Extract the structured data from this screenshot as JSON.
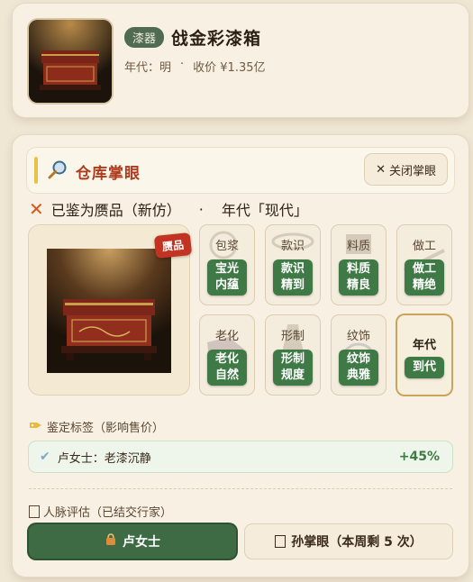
{
  "item": {
    "category": "漆器",
    "name": "戗金彩漆箱",
    "era_label": "年代：明",
    "separator": "·",
    "price_label": "收价 ¥1.35亿"
  },
  "inspection": {
    "title": "仓库掌眼",
    "close_label": "关闭掌眼",
    "verdict_text": "已鉴为赝品（新仿）",
    "verdict_sep": "·",
    "verdict_era": "年代「现代」",
    "stamp": "赝品"
  },
  "attributes": [
    {
      "label": "包浆",
      "value": "宝光内蕴"
    },
    {
      "label": "款识",
      "value": "款识精到"
    },
    {
      "label": "料质",
      "value": "料质精良"
    },
    {
      "label": "做工",
      "value": "做工精绝"
    },
    {
      "label": "老化",
      "value": "老化自然"
    },
    {
      "label": "形制",
      "value": "形制规度"
    },
    {
      "label": "纹饰",
      "value": "纹饰典雅"
    },
    {
      "label": "年代",
      "value": "到代"
    }
  ],
  "tags_section": {
    "label": "鉴定标签（影响售价）",
    "tags": [
      {
        "text": "卢女士：老漆沉静",
        "effect": "+45%"
      }
    ]
  },
  "network_section": {
    "label": "人脉评估（已结交行家）",
    "buttons": [
      {
        "label": "卢女士"
      },
      {
        "label": "孙掌眼（本周剩 5 次）"
      }
    ]
  },
  "colors": {
    "accent_green": "#3e6a44",
    "warning_red": "#c23321",
    "title_red": "#b03a1c",
    "gold": "#e9c24a"
  }
}
